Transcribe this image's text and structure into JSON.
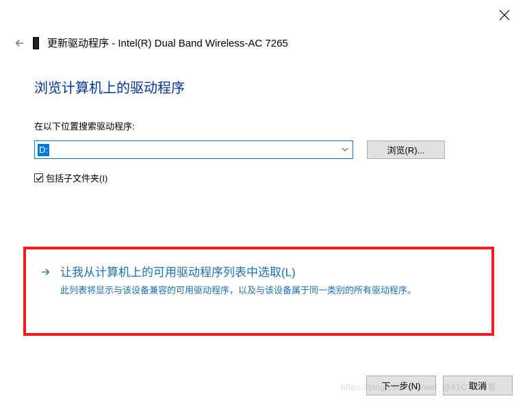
{
  "window": {
    "title": "更新驱动程序 - Intel(R) Dual Band Wireless-AC 7265"
  },
  "page": {
    "heading": "浏览计算机上的驱动程序"
  },
  "search": {
    "label": "在以下位置搜索驱动程序:",
    "path_value": "D:",
    "browse_label": "浏览(R)..."
  },
  "include_subfolders": {
    "label": "包括子文件夹(I)",
    "checked": true
  },
  "option_pick": {
    "title": "让我从计算机上的可用驱动程序列表中选取(L)",
    "description": "此列表将显示与该设备兼容的可用驱动程序，以及与该设备属于同一类别的所有驱动程序。"
  },
  "footer": {
    "next_label": "下一步(N)",
    "cancel_label": "取消"
  },
  "watermark": "https://blog.csdn.net/wei_@51CTO博客"
}
